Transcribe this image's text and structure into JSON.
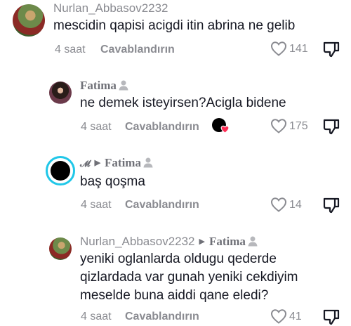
{
  "comments": [
    {
      "author": "Nurlan_Abbasov2232",
      "text": "mescidin qapisi acigdi itin abrina ne gelib",
      "time": "4 saat",
      "reply_label": "Cavablandırın",
      "likes": "141"
    },
    {
      "author": "Fatima",
      "text": "ne demek isteyirsen?Acigla bidene",
      "time": "4 saat",
      "reply_label": "Cavablandırın",
      "likes": "175"
    },
    {
      "author": "𝓜",
      "reply_to": "Fatima",
      "text": "baş qoşma",
      "time": "4 saat",
      "reply_label": "Cavablandırın",
      "likes": "14"
    },
    {
      "author": "Nurlan_Abbasov2232",
      "reply_to": "Fatima",
      "text_lines": [
        "yeniki oglanlarda oldugu qederde",
        "qizlardada var gunah yeniki cekdiyim",
        "meselde buna aiddi qane eledi?"
      ],
      "time": "4 saat",
      "reply_label": "Cavablandırın",
      "likes": "41"
    }
  ],
  "icons": {
    "like": "heart-outline-icon",
    "dislike": "thumbs-down-icon",
    "person": "person-icon",
    "reply_to": "triangle-right-icon"
  }
}
